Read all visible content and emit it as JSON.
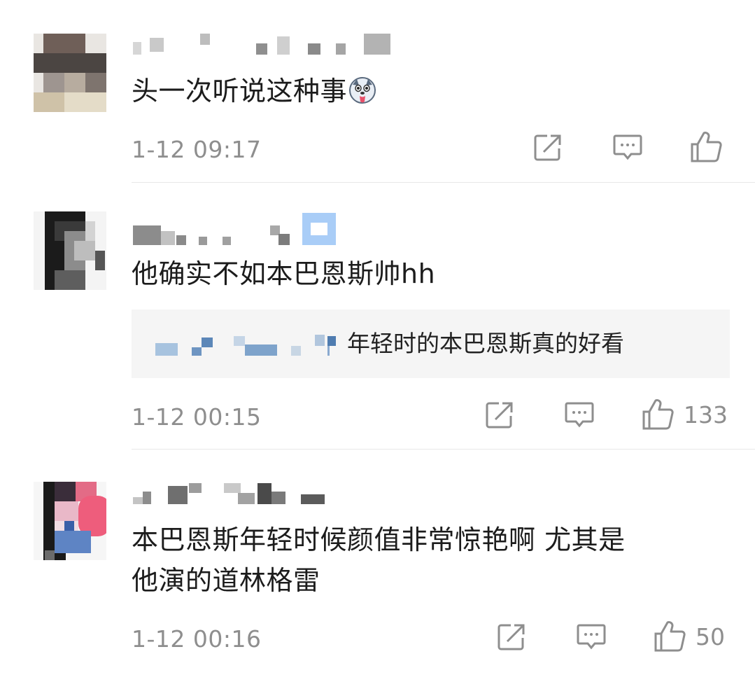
{
  "comments": [
    {
      "text": "头一次听说这种事",
      "emoji": "husky-tongue-emoji",
      "time": "1-12 09:17",
      "likes": ""
    },
    {
      "text": "他确实不如本巴恩斯帅hh",
      "time": "1-12 00:15",
      "likes": "133",
      "reply": {
        "text": "年轻时的本巴恩斯真的好看"
      }
    },
    {
      "text_line1": "本巴恩斯年轻时候颜值非常惊艳啊 尤其是",
      "text_line2": "他演的道林格雷",
      "time": "1-12 00:16",
      "likes": "50"
    }
  ],
  "icons": [
    "share-icon",
    "comment-icon",
    "like-icon"
  ],
  "colors": {
    "meta_gray": "#8e8e8e",
    "divider": "#e8e8e8",
    "reply_bg": "#f5f5f5"
  }
}
